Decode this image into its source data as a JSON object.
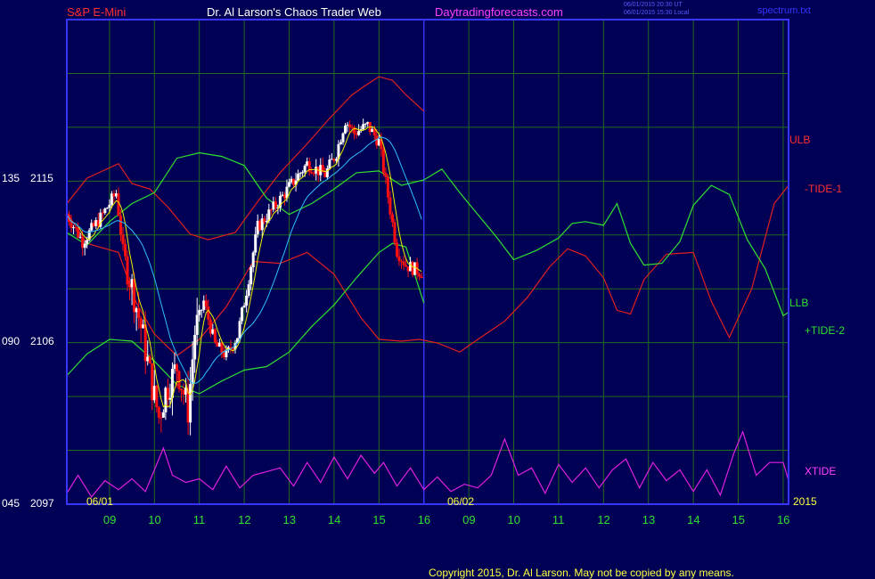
{
  "header": {
    "symbol": "S&P E-Mini",
    "title": "Dr. Al Larson's Chaos Trader Web",
    "site": "Daytradingforecasts.com",
    "stamp_utc": "06/01/2015 20:30 UT",
    "stamp_local": "06/01/2015 15:30 Local",
    "file": "spectrum.txt"
  },
  "footer": {
    "copyright": "Copyright 2015, Dr. Al Larson. May not be copied by any means."
  },
  "labels": {
    "ulb": "ULB",
    "tide1": "-TIDE-1",
    "llb": "LLB",
    "tide2": "+TIDE-2",
    "xtide": "XTIDE",
    "year": "2015",
    "date1": "06/01",
    "date2": "06/02"
  },
  "colors": {
    "background": "#000054",
    "frame": "#3535ff",
    "grid": "#1f6b1f",
    "ulb": "#e02020",
    "llb": "#e02020",
    "tide1": "#30e030",
    "tide2": "#30e030",
    "xtide": "#e020e0",
    "fast_ma": "#f0f000",
    "slow_ma": "#30c0ff",
    "bar_up": "#ffffff",
    "bar_down": "#ff1010",
    "title": "#ffffff",
    "symbol": "#ff3030",
    "site": "#ff40ff",
    "axis_text": "#ffffff",
    "hour_text": "#30e030"
  },
  "chart_data": {
    "type": "line",
    "title": "S&P E-Mini",
    "y_axis_ticks": [
      {
        "osc": "135",
        "price": "2115",
        "value": 2115
      },
      {
        "osc": "090",
        "price": "2106",
        "value": 2106
      },
      {
        "osc": "045",
        "price": "2097",
        "value": 2097
      }
    ],
    "ylim": [
      2097,
      2115
    ],
    "x_ticks": [
      "09",
      "10",
      "11",
      "12",
      "13",
      "14",
      "15",
      "16",
      "09",
      "10",
      "11",
      "12",
      "13",
      "14",
      "15",
      "16"
    ],
    "x_range_hours": [
      8.05,
      24.12
    ],
    "day_divider_hour": 16.0,
    "day_labels": [
      "06/01",
      "06/02"
    ],
    "bars_range_hours": [
      8.05,
      15.95
    ],
    "bars_anchor_close": [
      [
        8.05,
        2113.0
      ],
      [
        8.4,
        2111.5
      ],
      [
        8.8,
        2112.8
      ],
      [
        9.15,
        2114.2
      ],
      [
        9.3,
        2111.0
      ],
      [
        9.55,
        2108.5
      ],
      [
        9.75,
        2106.2
      ],
      [
        9.95,
        2103.5
      ],
      [
        10.1,
        2101.8
      ],
      [
        10.25,
        2103.2
      ],
      [
        10.5,
        2104.6
      ],
      [
        10.75,
        2102.2
      ],
      [
        10.9,
        2106.5
      ],
      [
        11.1,
        2108.2
      ],
      [
        11.35,
        2105.8
      ],
      [
        11.6,
        2105.2
      ],
      [
        11.85,
        2106.3
      ],
      [
        12.05,
        2108.8
      ],
      [
        12.3,
        2112.3
      ],
      [
        12.7,
        2113.5
      ],
      [
        13.0,
        2114.5
      ],
      [
        13.4,
        2115.8
      ],
      [
        13.8,
        2115.2
      ],
      [
        14.05,
        2116.4
      ],
      [
        14.25,
        2118.2
      ],
      [
        14.45,
        2117.5
      ],
      [
        14.75,
        2117.9
      ],
      [
        15.0,
        2117.0
      ],
      [
        15.2,
        2114.0
      ],
      [
        15.4,
        2111.0
      ],
      [
        15.6,
        2110.2
      ],
      [
        15.95,
        2109.8
      ]
    ],
    "series": [
      {
        "name": "ULB",
        "x": [
          8.05,
          8.5,
          9.2,
          9.5,
          9.9,
          10.3,
          10.8,
          11.2,
          11.8,
          12.3,
          12.8,
          13.4,
          13.9,
          14.4,
          14.75,
          15.0,
          15.3,
          15.6,
          16.0
        ],
        "values": [
          2113.6,
          2115.0,
          2115.8,
          2114.7,
          2114.4,
          2113.4,
          2111.9,
          2111.6,
          2112.0,
          2113.7,
          2115.3,
          2116.9,
          2118.3,
          2119.6,
          2120.2,
          2120.6,
          2120.4,
          2119.6,
          2118.7
        ]
      },
      {
        "name": "LLB",
        "x": [
          8.05,
          8.5,
          9.2,
          9.6,
          10.0,
          10.5,
          11.0,
          11.6,
          12.2,
          12.8,
          13.4,
          14.0,
          14.6,
          15.0,
          15.5,
          15.9,
          16.3,
          16.8,
          17.2,
          17.8,
          18.3,
          18.8,
          19.2,
          19.6,
          20.0,
          20.3,
          20.6,
          20.9,
          21.4,
          22.0,
          22.4,
          22.8,
          23.3,
          23.8,
          24.12
        ],
        "values": [
          2113.1,
          2111.4,
          2110.9,
          2108.1,
          2106.4,
          2105.2,
          2106.1,
          2107.9,
          2110.4,
          2110.3,
          2110.9,
          2109.7,
          2107.3,
          2106.1,
          2106.0,
          2106.1,
          2105.9,
          2105.4,
          2106.1,
          2107.1,
          2108.4,
          2110.1,
          2111.1,
          2110.7,
          2109.5,
          2107.7,
          2107.5,
          2109.4,
          2110.8,
          2110.9,
          2108.2,
          2106.2,
          2108.9,
          2113.6,
          2114.6
        ]
      },
      {
        "name": "-TIDE-1",
        "x": [
          8.05,
          8.5,
          9.0,
          9.5,
          10.0,
          10.5,
          11.0,
          11.5,
          12.0,
          12.5,
          13.0,
          13.5,
          14.0,
          14.5,
          15.0,
          15.5,
          16.0,
          16.4,
          16.8,
          17.2,
          17.6,
          18.0,
          18.5,
          19.0,
          19.3,
          19.6,
          20.0,
          20.3,
          20.6,
          20.9,
          21.3,
          21.7,
          22.0,
          22.4,
          22.8,
          23.2,
          23.6,
          24.0,
          24.12
        ],
        "values": [
          2112.0,
          2111.3,
          2112.6,
          2113.6,
          2114.2,
          2116.1,
          2116.4,
          2116.2,
          2115.7,
          2113.9,
          2113.0,
          2113.6,
          2114.4,
          2115.3,
          2115.4,
          2114.6,
          2114.9,
          2115.5,
          2114.2,
          2113.0,
          2111.8,
          2110.5,
          2111.0,
          2111.7,
          2112.5,
          2112.6,
          2112.4,
          2113.6,
          2111.4,
          2110.2,
          2110.3,
          2111.5,
          2113.5,
          2114.6,
          2114.1,
          2111.6,
          2110.0,
          2107.4,
          2107.6
        ]
      },
      {
        "name": "+TIDE-2",
        "x": [
          8.05,
          8.5,
          9.0,
          9.5,
          10.0,
          10.5,
          11.0,
          11.5,
          12.0,
          12.5,
          13.0,
          13.5,
          14.0,
          14.5,
          15.0,
          15.3,
          15.6,
          16.0
        ],
        "values": [
          2104.1,
          2105.3,
          2106.1,
          2106.0,
          2104.9,
          2103.6,
          2103.1,
          2103.8,
          2104.4,
          2104.6,
          2105.4,
          2106.8,
          2108.0,
          2109.5,
          2110.9,
          2111.4,
          2111.2,
          2108.1
        ]
      }
    ],
    "xtide": {
      "name": "XTIDE",
      "x": [
        8.05,
        8.3,
        8.6,
        8.9,
        9.2,
        9.5,
        9.8,
        10.0,
        10.2,
        10.4,
        10.7,
        11.0,
        11.3,
        11.6,
        11.9,
        12.2,
        12.5,
        12.8,
        13.1,
        13.4,
        13.7,
        14.0,
        14.3,
        14.6,
        14.9,
        15.1,
        15.4,
        15.7,
        16.0,
        16.3,
        16.6,
        16.9,
        17.2,
        17.5,
        17.8,
        18.1,
        18.4,
        18.7,
        19.0,
        19.3,
        19.6,
        19.9,
        20.2,
        20.5,
        20.8,
        21.1,
        21.4,
        21.7,
        22.0,
        22.3,
        22.6,
        22.9,
        23.1,
        23.4,
        23.7,
        24.0,
        24.12
      ],
      "values": [
        2097.6,
        2098.6,
        2097.4,
        2098.3,
        2097.8,
        2098.4,
        2097.7,
        2098.9,
        2100.1,
        2098.6,
        2098.2,
        2098.4,
        2097.8,
        2099.1,
        2097.9,
        2098.6,
        2098.8,
        2099.0,
        2098.0,
        2099.3,
        2098.2,
        2099.6,
        2098.4,
        2099.7,
        2098.7,
        2099.3,
        2098.0,
        2099.0,
        2097.8,
        2098.5,
        2097.7,
        2098.1,
        2097.9,
        2098.6,
        2100.6,
        2098.6,
        2099.0,
        2097.6,
        2099.2,
        2098.2,
        2099.0,
        2097.9,
        2098.9,
        2099.5,
        2097.9,
        2099.3,
        2098.3,
        2098.9,
        2097.7,
        2098.9,
        2097.5,
        2099.8,
        2101.0,
        2098.6,
        2099.3,
        2099.3,
        2098.3
      ]
    }
  }
}
